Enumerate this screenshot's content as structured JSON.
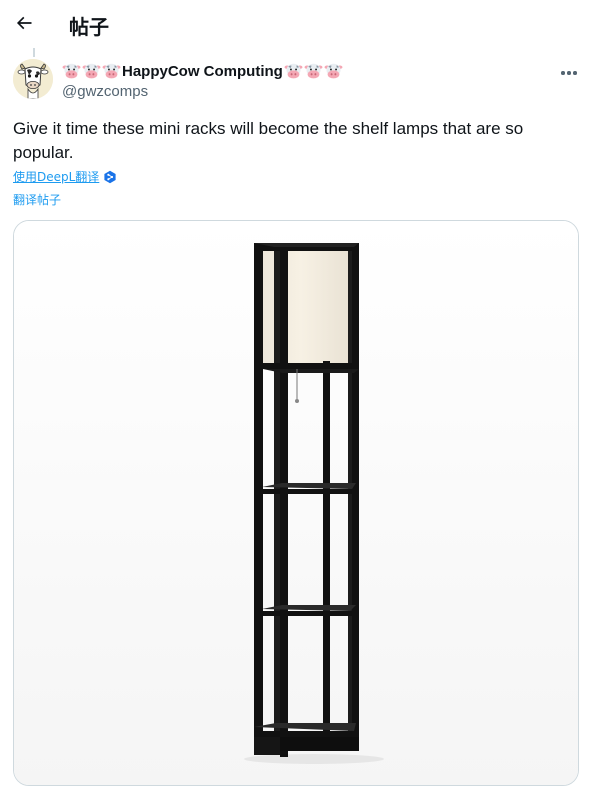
{
  "header": {
    "title": "帖子",
    "back_icon": "arrow-left-icon"
  },
  "post": {
    "author": {
      "display_name": "HappyCow Computing",
      "handle": "@gwzcomps",
      "name_emoji": "cow-face-icon",
      "avatar": "cow-avatar-icon"
    },
    "more_icon": "ellipsis-icon",
    "text": "Give it time these mini racks will become the shelf lamps that are so popular.",
    "deepl_label": "使用DeepL翻译",
    "deepl_icon": "deepl-icon",
    "translate_label": "翻译帖子",
    "media": {
      "subject": "shelf-floor-lamp-image"
    }
  },
  "colors": {
    "text": "#0f1419",
    "secondary": "#536471",
    "link": "#1d9bf0",
    "border": "#cfd9de"
  }
}
